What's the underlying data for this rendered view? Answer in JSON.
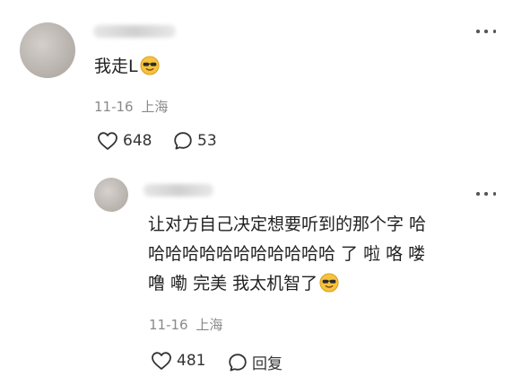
{
  "colors": {
    "meta_gray": "#8a8a8a",
    "text": "#222222",
    "emoji_yellow": "#f6c33c"
  },
  "icons": {
    "like": "heart-outline-icon",
    "reply": "speech-bubble-icon",
    "more": "more-dots-icon",
    "emoji": "sunglasses-emoji-icon"
  },
  "comment": {
    "text": "我走L",
    "date": "11-16",
    "location": "上海",
    "likes": "648",
    "replies": "53"
  },
  "reply": {
    "lines": [
      "让对方自己决定想要听到的那个字 哈",
      "哈哈哈哈哈哈哈哈哈哈哈 了 啦 咯 喽",
      "噜 嘞 完美 我太机智了"
    ],
    "date": "11-16",
    "location": "上海",
    "likes": "481",
    "reply_label": "回复"
  }
}
